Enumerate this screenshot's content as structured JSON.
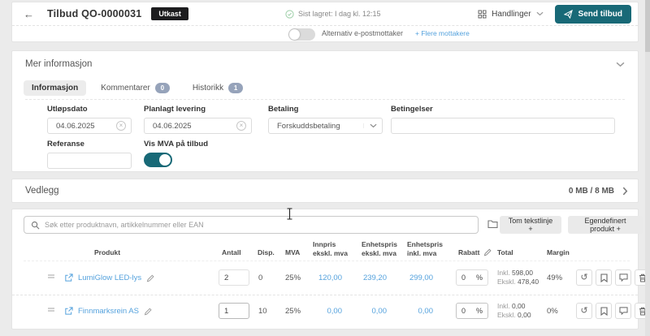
{
  "header": {
    "back": "←",
    "title": "Tilbud QO-0000031",
    "status": "Utkast",
    "saved": "Sist lagret: I dag kl. 12:15",
    "actions": "Handlinger",
    "send": "Send tilbud",
    "alt_email_label": "Alternativ e-postmottaker",
    "more_recipients": "+ Flere mottakere"
  },
  "more_info": {
    "title": "Mer informasjon",
    "tabs": [
      {
        "label": "Informasjon"
      },
      {
        "label": "Kommentarer",
        "badge": "0"
      },
      {
        "label": "Historikk",
        "badge": "1"
      }
    ],
    "expiry_label": "Utløpsdato",
    "expiry_value": "04.06.2025",
    "delivery_label": "Planlagt levering",
    "delivery_value": "04.06.2025",
    "payment_label": "Betaling",
    "payment_value": "Forskuddsbetaling",
    "terms_label": "Betingelser",
    "reference_label": "Referanse",
    "vat_toggle_label": "Vis MVA på tilbud"
  },
  "attachments": {
    "title": "Vedlegg",
    "usage": "0 MB / 8 MB"
  },
  "products": {
    "search_placeholder": "Søk etter produktnavn, artikkelnummer eller EAN",
    "empty_line_btn": "Tom tekstlinje +",
    "custom_product_btn": "Egendefinert produkt +",
    "col_product": "Produkt",
    "col_qty": "Antall",
    "col_disp": "Disp.",
    "col_vat": "MVA",
    "col_cost_1": "Innpris",
    "col_cost_2": "ekskl. mva",
    "col_unit_ex_1": "Enhetspris",
    "col_unit_ex_2": "ekskl. mva",
    "col_unit_in_1": "Enhetspris",
    "col_unit_in_2": "inkl. mva",
    "col_discount": "Rabatt",
    "col_total": "Total",
    "col_margin": "Margin",
    "rows": [
      {
        "name": "LumiGlow LED-lys",
        "qty": "2",
        "disp": "0",
        "vat": "25%",
        "cost": "120,00",
        "unit_ex": "239,20",
        "unit_in": "299,00",
        "discount": "0",
        "discount_unit": "%",
        "total_incl_label": "Inkl.",
        "total_incl": "598,00",
        "total_excl_label": "Ekskl.",
        "total_excl": "478,40",
        "margin": "49%"
      },
      {
        "name": "Finnmarksrein AS",
        "qty": "1",
        "disp": "10",
        "vat": "25%",
        "cost": "0,00",
        "unit_ex": "0,00",
        "unit_in": "0,00",
        "discount": "0",
        "discount_unit": "%",
        "total_incl_label": "Inkl.",
        "total_incl": "0,00",
        "total_excl_label": "Ekskl.",
        "total_excl": "0,00",
        "margin": "0%"
      }
    ]
  }
}
